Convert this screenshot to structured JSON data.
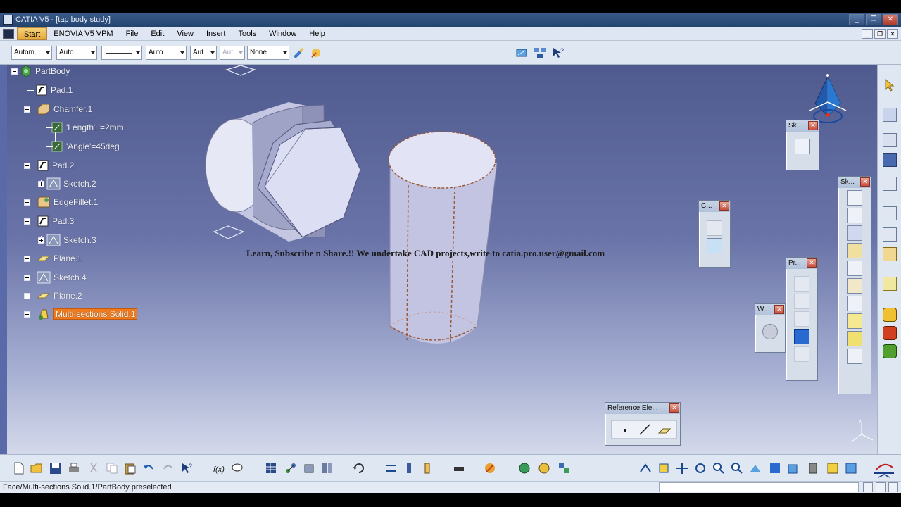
{
  "window": {
    "title": "CATIA V5 - [tap body study]"
  },
  "menu": {
    "items": [
      "Start",
      "ENOVIA V5 VPM",
      "File",
      "Edit",
      "View",
      "Insert",
      "Tools",
      "Window",
      "Help"
    ]
  },
  "toolbar_top": {
    "combos": [
      {
        "value": "Autom.",
        "disabled": false
      },
      {
        "value": "Auto",
        "disabled": false
      },
      {
        "value": "",
        "disabled": false
      },
      {
        "value": "Auto",
        "disabled": false
      },
      {
        "value": "Aut",
        "disabled": false
      },
      {
        "value": "Aut",
        "disabled": true
      },
      {
        "value": "None",
        "disabled": false
      }
    ]
  },
  "tree": {
    "nodes": [
      {
        "label": "PartBody",
        "icon": "partbody-icon"
      },
      {
        "label": "Pad.1",
        "icon": "pad-icon"
      },
      {
        "label": "Chamfer.1",
        "icon": "chamfer-icon"
      },
      {
        "label": "'Length1'=2mm",
        "icon": "parameter-icon"
      },
      {
        "label": "'Angle'=45deg",
        "icon": "parameter-icon"
      },
      {
        "label": "Pad.2",
        "icon": "pad-icon"
      },
      {
        "label": "Sketch.2",
        "icon": "sketch-icon"
      },
      {
        "label": "EdgeFillet.1",
        "icon": "edgefillet-icon"
      },
      {
        "label": "Pad.3",
        "icon": "pad-icon"
      },
      {
        "label": "Sketch.3",
        "icon": "sketch-icon"
      },
      {
        "label": "Plane.1",
        "icon": "plane-icon"
      },
      {
        "label": "Sketch.4",
        "icon": "sketch-icon"
      },
      {
        "label": "Plane.2",
        "icon": "plane-icon"
      },
      {
        "label": "Multi-sections Solid.1",
        "icon": "multisection-solid-icon",
        "selected": true
      }
    ]
  },
  "watermark": "Learn, Subscribe n Share.!! We undertake CAD projects,write to catia.pro.user@gmail.com",
  "floating_toolbars": {
    "sk1": "Sk...",
    "c": "C...",
    "sk2": "Sk...",
    "pr": "Pr...",
    "w": "W...",
    "reference": "Reference Ele..."
  },
  "status": {
    "message": "Face/Multi-sections Solid.1/PartBody preselected",
    "command_input": ""
  },
  "colors": {
    "selection": "#f07a1c",
    "viewport_top": "#4f5a8e",
    "viewport_bottom": "#d4d9ea"
  }
}
